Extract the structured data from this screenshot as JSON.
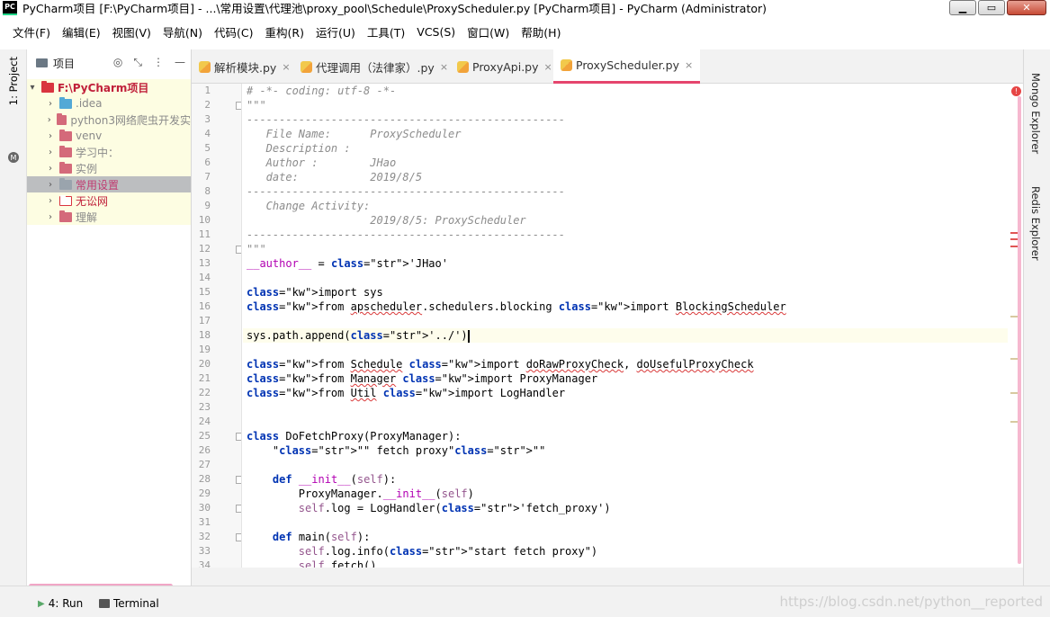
{
  "window": {
    "title": "PyCharm项目 [F:\\PyCharm项目] - ...\\常用设置\\代理池\\proxy_pool\\Schedule\\ProxyScheduler.py [PyCharm项目] - PyCharm (Administrator)",
    "logo": "PC"
  },
  "menu": [
    "文件(F)",
    "编辑(E)",
    "视图(V)",
    "导航(N)",
    "代码(C)",
    "重构(R)",
    "运行(U)",
    "工具(T)",
    "VCS(S)",
    "窗口(W)",
    "帮助(H)"
  ],
  "left_strip": {
    "project_tab": "1: Project"
  },
  "project_panel": {
    "title": "项目",
    "tree": [
      {
        "label": "F:\\PyCharm项目",
        "kind": "root"
      },
      {
        "label": ".idea",
        "kind": "idea"
      },
      {
        "label": "python3网络爬虫开发实",
        "kind": "muted"
      },
      {
        "label": "venv",
        "kind": "muted"
      },
      {
        "label": "学习中：",
        "kind": "muted"
      },
      {
        "label": "实例",
        "kind": "muted"
      },
      {
        "label": "常用设置",
        "kind": "selected"
      },
      {
        "label": "无讼网",
        "kind": "red"
      },
      {
        "label": "理解",
        "kind": "muted"
      }
    ]
  },
  "tabs": [
    "解析模块.py",
    "代理调用（法律家）.py",
    "ProxyApi.py",
    "ProxyScheduler.py"
  ],
  "active_tab": "ProxyScheduler.py",
  "editor": {
    "line_numbers": [
      "1",
      "2",
      "3",
      "4",
      "5",
      "6",
      "7",
      "8",
      "9",
      "10",
      "11",
      "12",
      "13",
      "14",
      "15",
      "16",
      "17",
      "18",
      "19",
      "20",
      "21",
      "22",
      "23",
      "24",
      "25",
      "26",
      "27",
      "28",
      "29",
      "30",
      "31",
      "32",
      "33",
      "34"
    ],
    "lines": [
      "# -*- coding: utf-8 -*-",
      "\"\"\"",
      "-------------------------------------------------",
      "   File Name:      ProxyScheduler",
      "   Description :",
      "   Author :        JHao",
      "   date:           2019/8/5",
      "-------------------------------------------------",
      "   Change Activity:",
      "                   2019/8/5: ProxyScheduler",
      "-------------------------------------------------",
      "\"\"\"",
      "__author__ = 'JHao'",
      "",
      "import sys",
      "from apscheduler.schedulers.blocking import BlockingScheduler",
      "",
      "sys.path.append('../')",
      "",
      "from Schedule import doRawProxyCheck, doUsefulProxyCheck",
      "from Manager import ProxyManager",
      "from Util import LogHandler",
      "",
      "",
      "class DoFetchProxy(ProxyManager):",
      "    \"\"\" fetch proxy\"\"\"",
      "",
      "    def __init__(self):",
      "        ProxyManager.__init__(self)",
      "        self.log = LogHandler('fetch_proxy')",
      "",
      "    def main(self):",
      "        self.log.info(\"start fetch proxy\")",
      "        self.fetch()"
    ]
  },
  "right_strip": {
    "mongo": "Mongo Explorer",
    "redis": "Redis Explorer"
  },
  "status": {
    "run": "4: Run",
    "terminal": "Terminal",
    "watermark": "https://blog.csdn.net/python__reported"
  },
  "colors": {
    "accent": "#e5456d",
    "current_line": "#fefdec",
    "keyword": "#0033b3",
    "string": "#067d17"
  }
}
